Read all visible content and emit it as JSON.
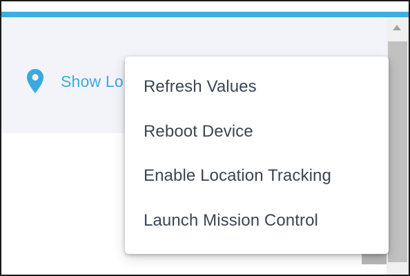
{
  "header": {
    "location_link_label": "Show Lo",
    "location_icon": "map-pin-icon"
  },
  "context_menu": {
    "items": [
      {
        "label": "Refresh Values"
      },
      {
        "label": "Reboot Device"
      },
      {
        "label": "Enable Location Tracking"
      },
      {
        "label": "Launch Mission Control"
      }
    ]
  },
  "colors": {
    "accent": "#3daee3",
    "link": "#3ba9de",
    "menu_text": "#3b4552",
    "header_bg": "#f3f4fa"
  }
}
